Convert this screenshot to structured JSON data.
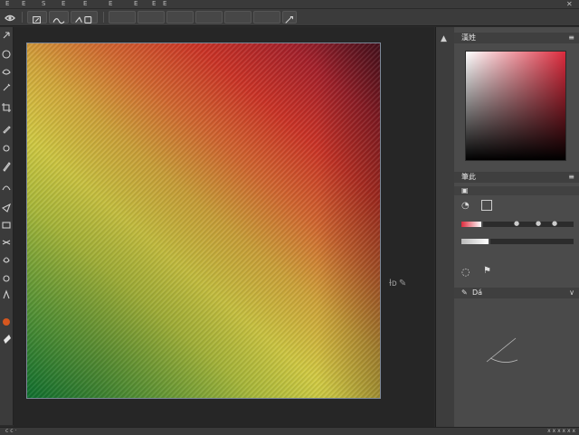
{
  "menubar": {
    "items": [
      "E",
      "E",
      "S",
      "E",
      "E",
      "E",
      "E",
      "E",
      "E"
    ],
    "right_icons": [
      "close-icon"
    ]
  },
  "options_bar": {
    "tools": [
      "eye-icon",
      "brush-preset-icon",
      "wave-brush-icon",
      "pressure-icon",
      "airbrush-icon"
    ]
  },
  "toolbar": {
    "tools": [
      "move-icon",
      "marquee-icon",
      "lasso-icon",
      "magic-wand-icon",
      "crop-icon",
      "eyedropper-icon",
      "healing-icon",
      "brush-icon",
      "clone-stamp-icon",
      "history-brush-icon",
      "eraser-icon",
      "gradient-icon",
      "blur-icon",
      "dodge-icon",
      "pen-icon",
      "text-icon",
      "path-select-icon",
      "shape-icon",
      "hand-icon",
      "zoom-icon"
    ]
  },
  "canvas": {
    "brush_readout_glyphs": "ƚᴅ"
  },
  "color_panel": {
    "title": "漢姓",
    "accent": "#dc2b3d"
  },
  "brush_panel": {
    "title": "筆此",
    "preview_label": "Dá"
  },
  "status": {
    "left": "с с ·",
    "right": "x x x x x x"
  },
  "colors": {
    "canvas_start": "#0f7f35",
    "canvas_mid": "#d6cf44",
    "canvas_end": "#5b1423",
    "panel_bg": "#4b4b4b"
  }
}
